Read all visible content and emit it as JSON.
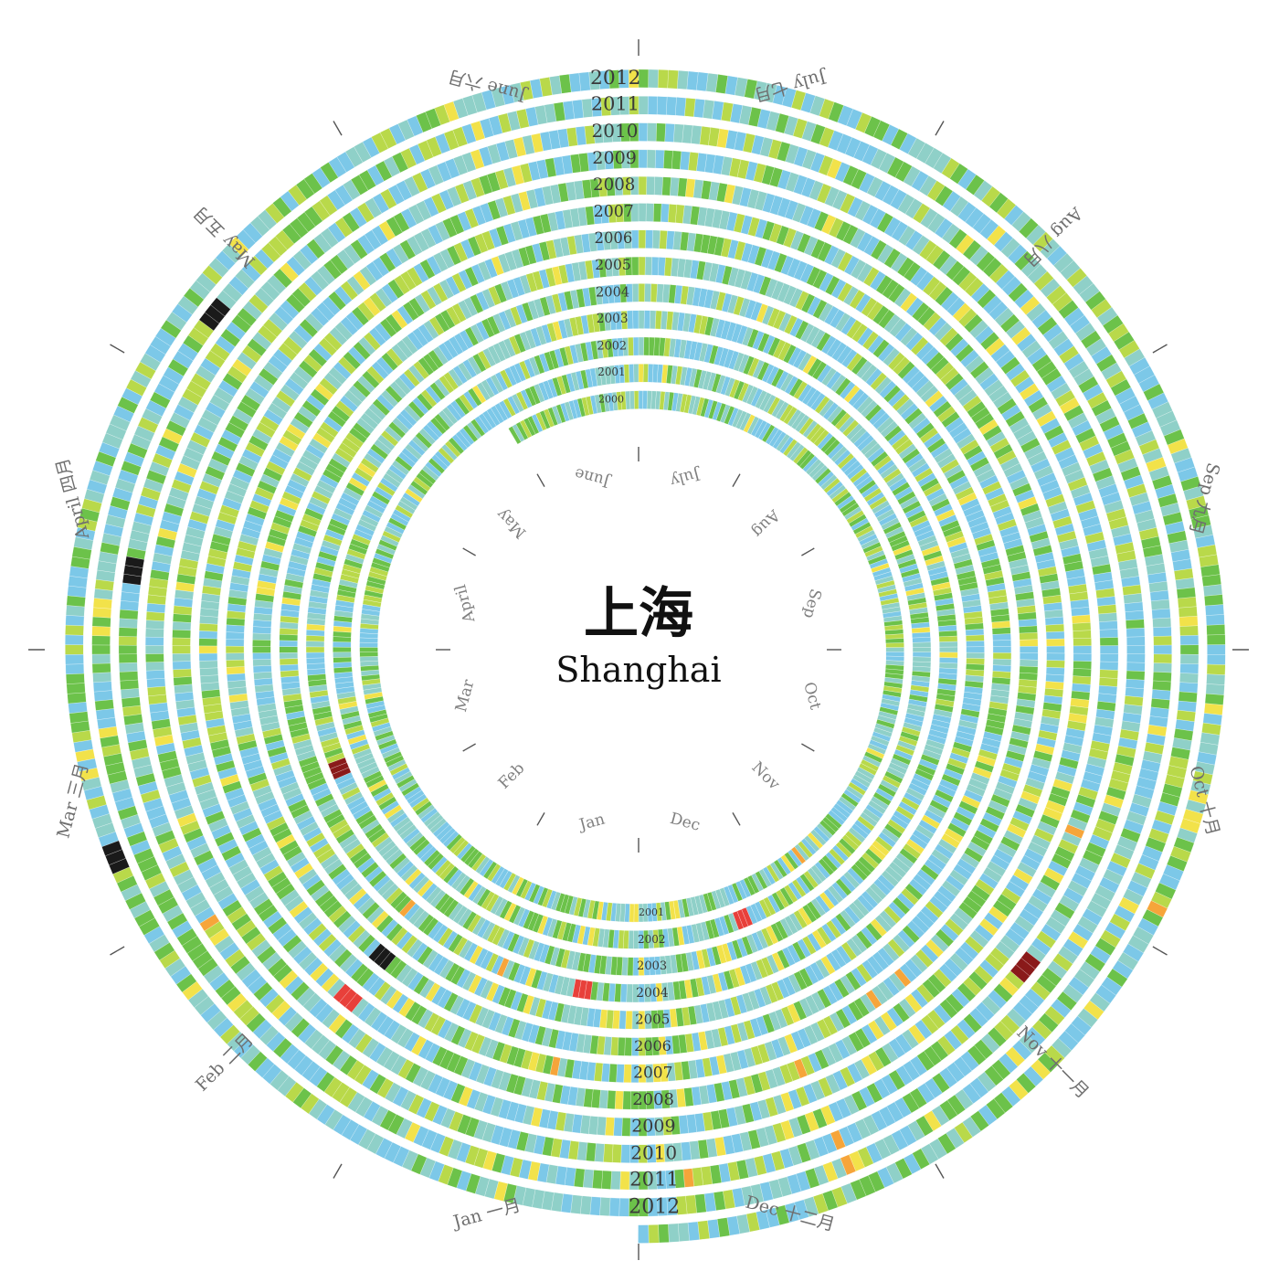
{
  "title": {
    "chinese": "上海",
    "english": "Shanghai"
  },
  "chart_data": {
    "type": "heatmap",
    "layout": "spiral calendar",
    "start": "2000-06",
    "end": "2012-12",
    "years": [
      "2000",
      "2001",
      "2002",
      "2003",
      "2004",
      "2005",
      "2006",
      "2007",
      "2008",
      "2009",
      "2010",
      "2011",
      "2012"
    ],
    "bottom_year_labels": [
      "2001",
      "2002",
      "2003",
      "2004",
      "2005",
      "2006",
      "2007",
      "2008",
      "2009",
      "2010",
      "2011",
      "2012"
    ],
    "outer_month_labels": [
      "Jan 一月",
      "Feb 二月",
      "Mar 三月",
      "April 四月",
      "May 五月",
      "June 六月",
      "July 七月",
      "Aug 八月",
      "Sep 九月",
      "Oct 十月",
      "Nov 十一月",
      "Dec 十二月"
    ],
    "inner_month_labels": [
      "Jan",
      "Feb",
      "Mar",
      "April",
      "May",
      "June",
      "July",
      "Aug",
      "Sep",
      "Oct",
      "Nov",
      "Dec"
    ],
    "color_scale": [
      "#7cc8e8",
      "#8fd0c8",
      "#6cc24a",
      "#b9d94a",
      "#f2e24a",
      "#f6a53a",
      "#e8403a",
      "#8a1a1a",
      "#1a1a1a"
    ],
    "notable_extreme_cells": [
      {
        "year": "2001",
        "month": "Dec",
        "level": "red"
      },
      {
        "year": "2003",
        "month": "Mar",
        "level": "dark red"
      },
      {
        "year": "2004",
        "month": "Jan",
        "level": "red"
      },
      {
        "year": "2006",
        "month": "Feb",
        "level": "black"
      },
      {
        "year": "2008",
        "month": "Feb",
        "level": "red"
      },
      {
        "year": "2009",
        "month": "Nov",
        "level": "dark red"
      },
      {
        "year": "2010",
        "month": "April",
        "level": "black"
      },
      {
        "year": "2011",
        "month": "May",
        "level": "black"
      },
      {
        "year": "2012",
        "month": "Mar",
        "level": "black"
      }
    ]
  }
}
